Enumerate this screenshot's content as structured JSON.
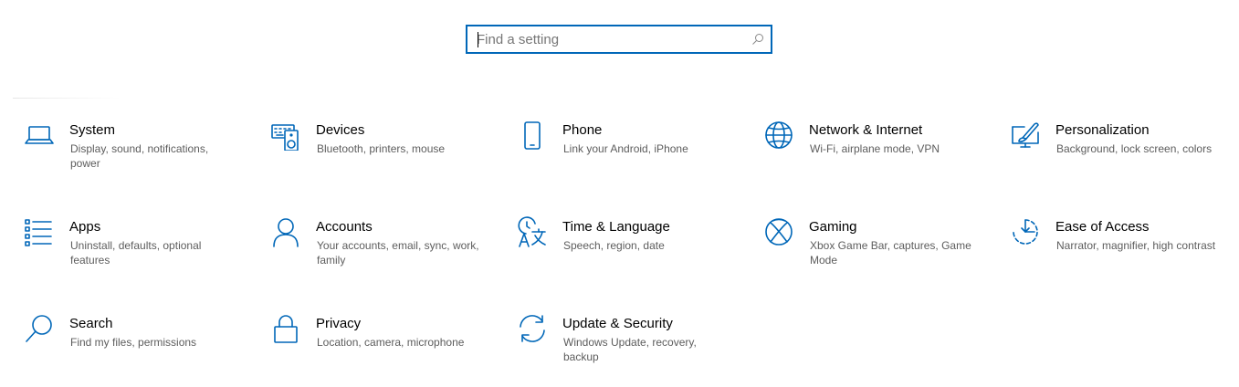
{
  "search": {
    "placeholder": "Find a setting"
  },
  "accent_color": "#0067b8",
  "tiles": [
    {
      "title": "System",
      "description": "Display, sound, notifications, power",
      "icon": "laptop-icon"
    },
    {
      "title": "Devices",
      "description": "Bluetooth, printers, mouse",
      "icon": "keyboard-speaker-icon"
    },
    {
      "title": "Phone",
      "description": "Link your Android, iPhone",
      "icon": "phone-icon"
    },
    {
      "title": "Network & Internet",
      "description": "Wi-Fi, airplane mode, VPN",
      "icon": "globe-icon"
    },
    {
      "title": "Personalization",
      "description": "Background, lock screen, colors",
      "icon": "paintbrush-icon"
    },
    {
      "title": "Apps",
      "description": "Uninstall, defaults, optional features",
      "icon": "apps-list-icon"
    },
    {
      "title": "Accounts",
      "description": "Your accounts, email, sync, work, family",
      "icon": "person-icon"
    },
    {
      "title": "Time & Language",
      "description": "Speech, region, date",
      "icon": "time-language-icon"
    },
    {
      "title": "Gaming",
      "description": "Xbox Game Bar, captures, Game Mode",
      "icon": "xbox-icon"
    },
    {
      "title": "Ease of Access",
      "description": "Narrator, magnifier, high contrast",
      "icon": "ease-of-access-icon"
    },
    {
      "title": "Search",
      "description": "Find my files, permissions",
      "icon": "search-icon"
    },
    {
      "title": "Privacy",
      "description": "Location, camera, microphone",
      "icon": "lock-icon"
    },
    {
      "title": "Update & Security",
      "description": "Windows Update, recovery, backup",
      "icon": "sync-icon"
    }
  ]
}
